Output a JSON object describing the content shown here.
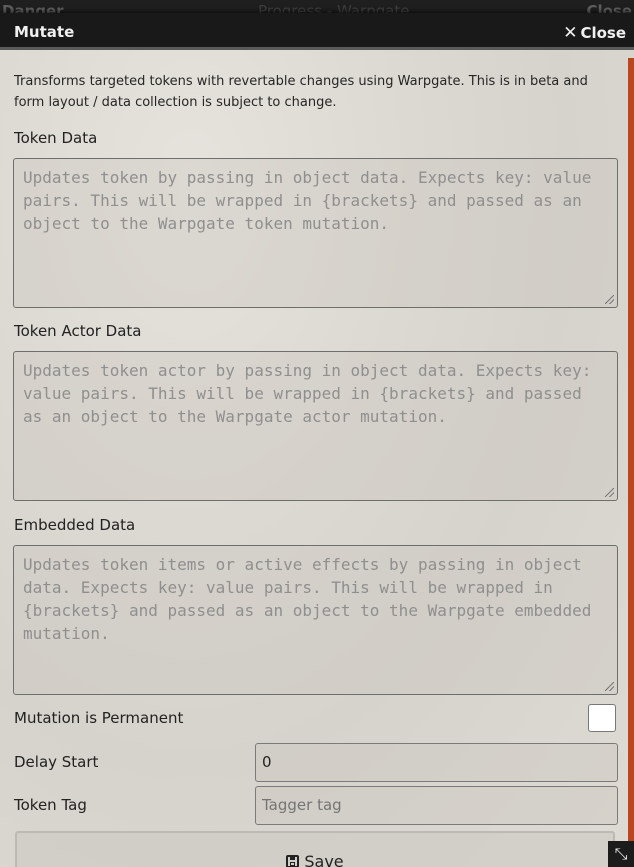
{
  "background_window": {
    "title_left": "Danger",
    "title_right": "Close",
    "center_text": "Progress  -  Warpgate"
  },
  "window": {
    "title": "Mutate",
    "close_label": "Close"
  },
  "description": "Transforms targeted tokens with revertable changes using Warpgate. This is in beta and form layout / data collection is subject to change.",
  "fields": {
    "token_data": {
      "label": "Token Data",
      "placeholder": "Updates token by passing in object data. Expects key: value pairs. This will be wrapped in {brackets} and passed as an object to the Warpgate token mutation."
    },
    "actor_data": {
      "label": "Token Actor Data",
      "placeholder": "Updates token actor by passing in object data. Expects key: value pairs. This will be wrapped in {brackets} and passed as an object to the Warpgate actor mutation."
    },
    "embedded_data": {
      "label": "Embedded Data",
      "placeholder": "Updates token items or active effects by passing in object data. Expects key: value pairs. This will be wrapped in {brackets} and passed as an object to the Warpgate embedded mutation."
    },
    "permanent": {
      "label": "Mutation is Permanent",
      "checked": false
    },
    "delay": {
      "label": "Delay Start",
      "value": "0"
    },
    "tag": {
      "label": "Token Tag",
      "placeholder": "Tagger tag"
    }
  },
  "save_label": "Save",
  "icons": {
    "close": "close-icon",
    "save": "floppy-disk-icon",
    "resize": "resize-handle-icon"
  },
  "colors": {
    "titlebar": "#191919",
    "scrollbar": "#b8461e",
    "panel": "#dcd9d2"
  }
}
